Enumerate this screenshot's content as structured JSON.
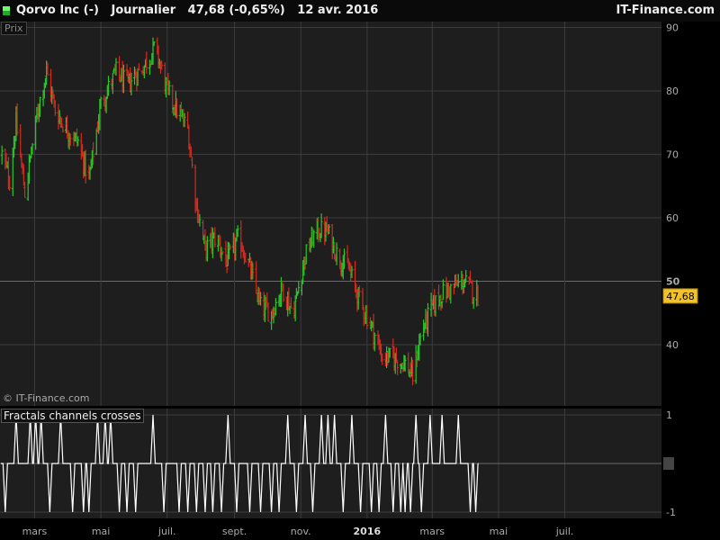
{
  "header": {
    "title": "Qorvo Inc (-)   Journalier   47,68 (-0,65%)   12 avr. 2016",
    "site": "IT-Finance.com"
  },
  "main_panel": {
    "label": "Prix",
    "copyright": "© IT-Finance.com",
    "last_price_label": "47,68",
    "yticks": [
      "40",
      "50",
      "60",
      "70",
      "80",
      "90"
    ],
    "highlight_tick": "50"
  },
  "indicator_panel": {
    "title": "Fractals channels crosses",
    "yticks": [
      "-1",
      "0",
      "1"
    ]
  },
  "xaxis": {
    "ticks": [
      "mars",
      "mai",
      "juil.",
      "sept.",
      "nov.",
      "2016",
      "mars",
      "mai",
      "juil."
    ],
    "bold_tick": "2016"
  },
  "colors": {
    "up": "#29c729",
    "down": "#d42a1f",
    "grid": "#3c3c3c",
    "price_marker_bg": "#f2c22b",
    "indicator_line": "#ffffff"
  },
  "chart_data": [
    {
      "type": "ohlc",
      "title": "Qorvo Inc (-) Journalier",
      "ylabel": "Prix",
      "ylim": [
        32,
        92
      ],
      "last_value": 47.68,
      "grid": true,
      "x_start_label": "2015-02",
      "anchors": [
        [
          "2015-01-30",
          70
        ],
        [
          "2015-02-06",
          66
        ],
        [
          "2015-02-12",
          75
        ],
        [
          "2015-02-20",
          64
        ],
        [
          "2015-03-05",
          78
        ],
        [
          "2015-03-12",
          83
        ],
        [
          "2015-03-20",
          77
        ],
        [
          "2015-03-30",
          74
        ],
        [
          "2015-04-10",
          72
        ],
        [
          "2015-04-20",
          66
        ],
        [
          "2015-05-01",
          78
        ],
        [
          "2015-05-15",
          83
        ],
        [
          "2015-05-25",
          81
        ],
        [
          "2015-06-10",
          84
        ],
        [
          "2015-06-20",
          87
        ],
        [
          "2015-07-01",
          80
        ],
        [
          "2015-07-10",
          77
        ],
        [
          "2015-07-20",
          74
        ],
        [
          "2015-07-28",
          62
        ],
        [
          "2015-08-05",
          55
        ],
        [
          "2015-08-15",
          57
        ],
        [
          "2015-08-25",
          53
        ],
        [
          "2015-09-05",
          57
        ],
        [
          "2015-09-15",
          52
        ],
        [
          "2015-09-25",
          46
        ],
        [
          "2015-10-05",
          45
        ],
        [
          "2015-10-15",
          49
        ],
        [
          "2015-10-25",
          45
        ],
        [
          "2015-11-05",
          54
        ],
        [
          "2015-11-15",
          58
        ],
        [
          "2015-11-25",
          58
        ],
        [
          "2015-12-05",
          54
        ],
        [
          "2015-12-15",
          52
        ],
        [
          "2015-12-25",
          47
        ],
        [
          "2016-01-05",
          43
        ],
        [
          "2016-01-15",
          38
        ],
        [
          "2016-01-25",
          38
        ],
        [
          "2016-02-05",
          37
        ],
        [
          "2016-02-12",
          35
        ],
        [
          "2016-02-20",
          42
        ],
        [
          "2016-03-01",
          46
        ],
        [
          "2016-03-10",
          48
        ],
        [
          "2016-03-20",
          49
        ],
        [
          "2016-03-30",
          50
        ],
        [
          "2016-04-05",
          49
        ],
        [
          "2016-04-12",
          47.68
        ]
      ]
    },
    {
      "type": "line",
      "title": "Fractals channels crosses",
      "ylim": [
        -1,
        1
      ],
      "x_start": "2015-01-29",
      "x_end": "2016-04-12",
      "spikes": [
        [
          "2015-02-02",
          -1
        ],
        [
          "2015-02-12",
          1
        ],
        [
          "2015-02-25",
          1
        ],
        [
          "2015-03-02",
          1
        ],
        [
          "2015-03-07",
          1
        ],
        [
          "2015-03-15",
          -1
        ],
        [
          "2015-03-25",
          1
        ],
        [
          "2015-04-05",
          -1
        ],
        [
          "2015-04-15",
          -1
        ],
        [
          "2015-04-20",
          -1
        ],
        [
          "2015-04-28",
          1
        ],
        [
          "2015-05-05",
          1
        ],
        [
          "2015-05-10",
          1
        ],
        [
          "2015-05-18",
          -1
        ],
        [
          "2015-05-25",
          -1
        ],
        [
          "2015-06-02",
          -1
        ],
        [
          "2015-06-18",
          1
        ],
        [
          "2015-06-28",
          -1
        ],
        [
          "2015-07-12",
          -1
        ],
        [
          "2015-07-20",
          -1
        ],
        [
          "2015-07-28",
          -1
        ],
        [
          "2015-08-05",
          -1
        ],
        [
          "2015-08-12",
          -1
        ],
        [
          "2015-08-20",
          -1
        ],
        [
          "2015-08-26",
          1
        ],
        [
          "2015-09-03",
          -1
        ],
        [
          "2015-09-15",
          -1
        ],
        [
          "2015-09-25",
          -1
        ],
        [
          "2015-10-05",
          -1
        ],
        [
          "2015-10-12",
          -1
        ],
        [
          "2015-10-20",
          1
        ],
        [
          "2015-10-28",
          -1
        ],
        [
          "2015-11-05",
          1
        ],
        [
          "2015-11-12",
          -1
        ],
        [
          "2015-11-20",
          1
        ],
        [
          "2015-11-26",
          1
        ],
        [
          "2015-12-02",
          1
        ],
        [
          "2015-12-10",
          -1
        ],
        [
          "2015-12-18",
          1
        ],
        [
          "2015-12-26",
          -1
        ],
        [
          "2016-01-05",
          -1
        ],
        [
          "2016-01-12",
          -1
        ],
        [
          "2016-01-18",
          1
        ],
        [
          "2016-01-25",
          -1
        ],
        [
          "2016-02-01",
          -1
        ],
        [
          "2016-02-05",
          -1
        ],
        [
          "2016-02-10",
          -1
        ],
        [
          "2016-02-15",
          1
        ],
        [
          "2016-02-20",
          -1
        ],
        [
          "2016-02-28",
          1
        ],
        [
          "2016-03-10",
          1
        ],
        [
          "2016-03-25",
          1
        ],
        [
          "2016-04-05",
          -1
        ],
        [
          "2016-04-10",
          -1
        ]
      ]
    }
  ]
}
